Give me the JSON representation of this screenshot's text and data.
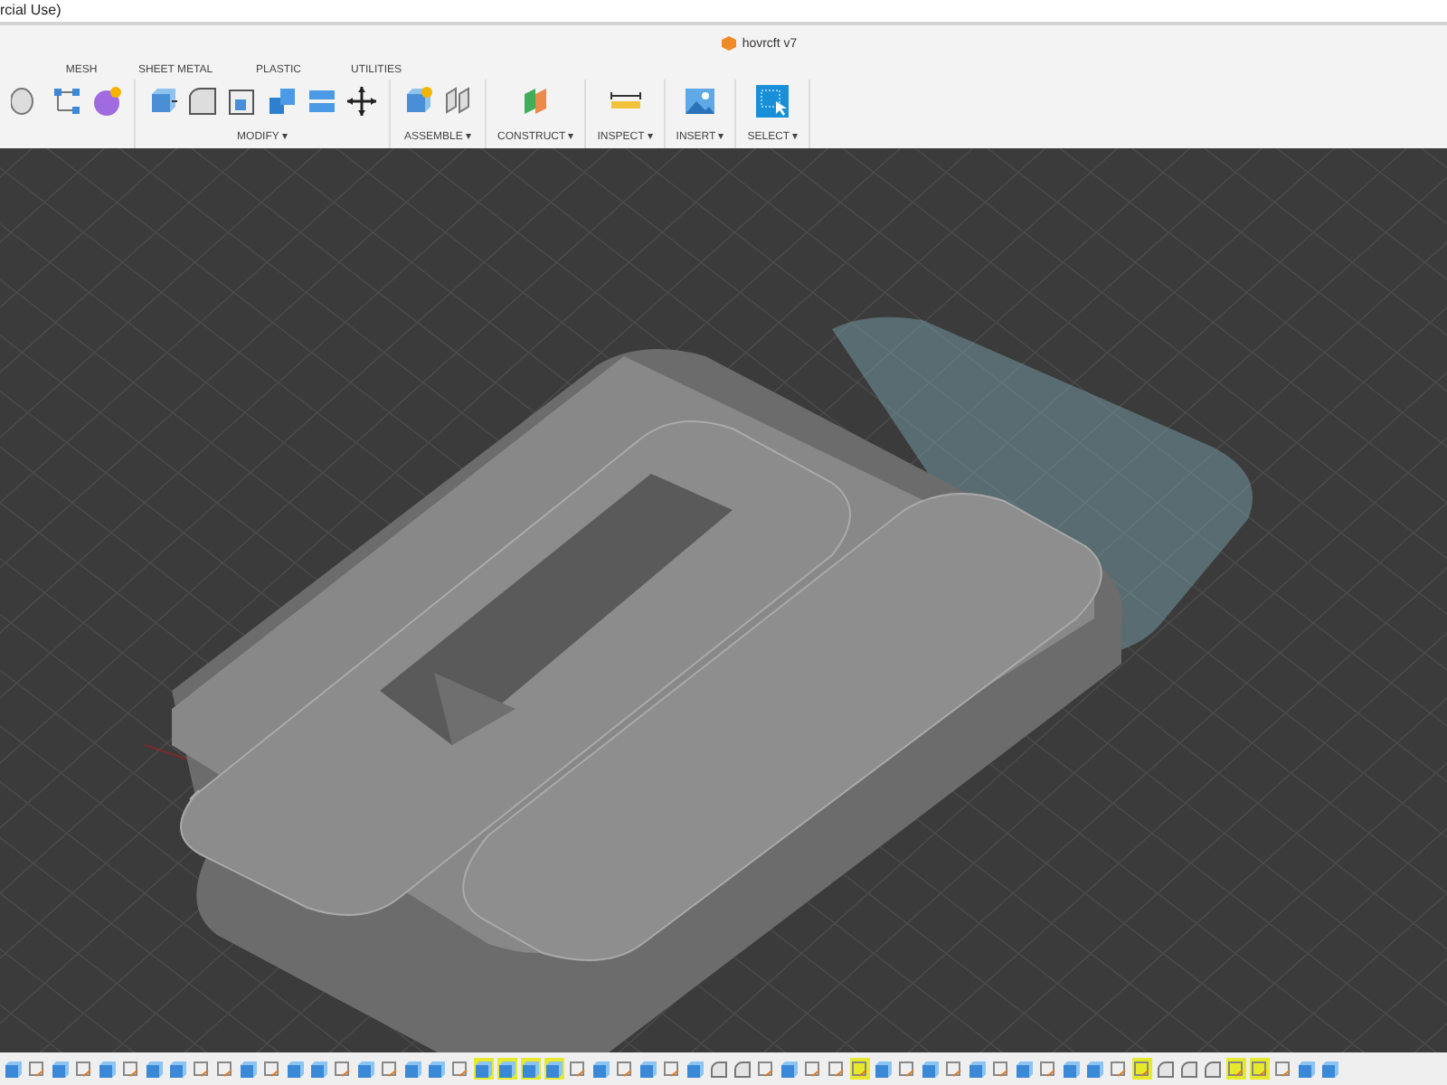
{
  "window": {
    "title": "rcial Use)"
  },
  "document_tab": {
    "title": "hovrcft v7"
  },
  "toolbar_tabs": [
    {
      "label": "MESH"
    },
    {
      "label": "SHEET METAL"
    },
    {
      "label": "PLASTIC"
    },
    {
      "label": "UTILITIES"
    }
  ],
  "toolbar_groups": [
    {
      "label": "MODIFY ▾"
    },
    {
      "label": "ASSEMBLE ▾"
    },
    {
      "label": "CONSTRUCT ▾"
    },
    {
      "label": "INSPECT ▾"
    },
    {
      "label": "INSERT ▾"
    },
    {
      "label": "SELECT ▾"
    }
  ],
  "timeline": [
    {
      "kind": "extrude",
      "selected": false
    },
    {
      "kind": "sketch",
      "selected": false
    },
    {
      "kind": "extrude",
      "selected": false
    },
    {
      "kind": "sketch",
      "selected": false
    },
    {
      "kind": "extrude",
      "selected": false
    },
    {
      "kind": "sketch",
      "selected": false
    },
    {
      "kind": "extrude",
      "selected": false
    },
    {
      "kind": "extrude",
      "selected": false
    },
    {
      "kind": "sketch",
      "selected": false
    },
    {
      "kind": "sketch",
      "selected": false
    },
    {
      "kind": "extrude",
      "selected": false
    },
    {
      "kind": "sketch",
      "selected": false
    },
    {
      "kind": "extrude",
      "selected": false
    },
    {
      "kind": "extrude",
      "selected": false
    },
    {
      "kind": "sketch",
      "selected": false
    },
    {
      "kind": "extrude",
      "selected": false
    },
    {
      "kind": "sketch",
      "selected": false
    },
    {
      "kind": "extrude",
      "selected": false
    },
    {
      "kind": "extrude",
      "selected": false
    },
    {
      "kind": "sketch",
      "selected": false
    },
    {
      "kind": "extrude",
      "selected": true
    },
    {
      "kind": "extrude",
      "selected": true
    },
    {
      "kind": "extrude",
      "selected": true
    },
    {
      "kind": "extrude",
      "selected": true
    },
    {
      "kind": "sketch",
      "selected": false
    },
    {
      "kind": "extrude",
      "selected": false
    },
    {
      "kind": "sketch",
      "selected": false
    },
    {
      "kind": "extrude",
      "selected": false
    },
    {
      "kind": "sketch",
      "selected": false
    },
    {
      "kind": "extrude",
      "selected": false
    },
    {
      "kind": "fillet",
      "selected": false
    },
    {
      "kind": "fillet",
      "selected": false
    },
    {
      "kind": "sketch",
      "selected": false
    },
    {
      "kind": "extrude",
      "selected": false
    },
    {
      "kind": "sketch",
      "selected": false
    },
    {
      "kind": "sketch",
      "selected": false
    },
    {
      "kind": "sketch",
      "selected": true
    },
    {
      "kind": "extrude",
      "selected": false
    },
    {
      "kind": "sketch",
      "selected": false
    },
    {
      "kind": "extrude",
      "selected": false
    },
    {
      "kind": "sketch",
      "selected": false
    },
    {
      "kind": "extrude",
      "selected": false
    },
    {
      "kind": "sketch",
      "selected": false
    },
    {
      "kind": "extrude",
      "selected": false
    },
    {
      "kind": "sketch",
      "selected": false
    },
    {
      "kind": "extrude",
      "selected": false
    },
    {
      "kind": "extrude",
      "selected": false
    },
    {
      "kind": "sketch",
      "selected": false
    },
    {
      "kind": "sketch",
      "selected": true
    },
    {
      "kind": "fillet",
      "selected": false
    },
    {
      "kind": "fillet",
      "selected": false
    },
    {
      "kind": "fillet",
      "selected": false
    },
    {
      "kind": "sketch",
      "selected": true
    },
    {
      "kind": "sketch",
      "selected": true
    },
    {
      "kind": "sketch",
      "selected": false
    },
    {
      "kind": "extrude",
      "selected": false
    },
    {
      "kind": "extrude",
      "selected": false
    }
  ]
}
